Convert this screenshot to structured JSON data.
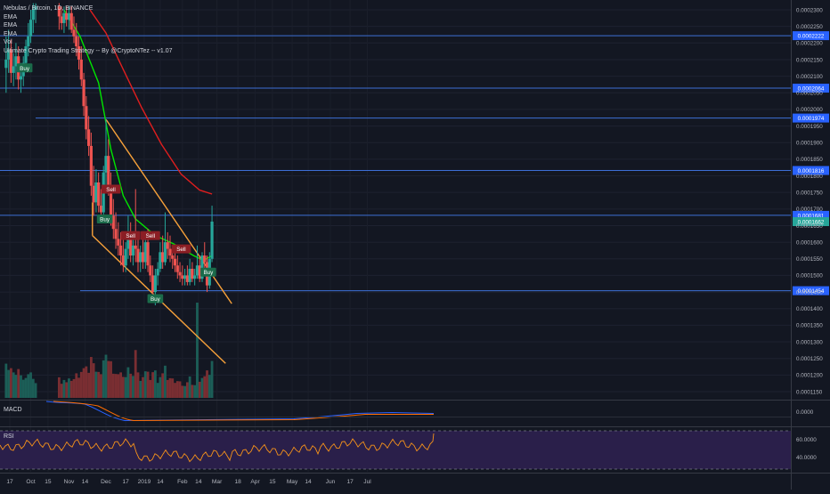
{
  "header": {
    "symbol_title": "Nebulas / Bitcoin, 1D, BINANCE",
    "indicators": [
      "EMA",
      "EMA",
      "EMA",
      "Vol",
      "Ultimate Crypto Trading Strategy -- By @CryptoNTez -- v1.07"
    ]
  },
  "panes": {
    "macd_label": "MACD",
    "macd_value": "0.0000",
    "rsi_label": "RSI",
    "rsi_ticks": [
      "60.0000",
      "40.0000"
    ]
  },
  "colors": {
    "background": "#131722",
    "up": "#26a69a",
    "down": "#ef5350",
    "ema_fast": "#00e600",
    "ema_slow": "#e01e1e",
    "trendline": "#f7a13a",
    "hline": "#3d6fd6",
    "rsi_band": "#2a1f4a",
    "rsi_line": "#f7931a",
    "macd_line": "#2962ff",
    "signal_line": "#ff6d00"
  },
  "chart_data": {
    "type": "candlestick",
    "y_ticks": [
      "0.0002300",
      "0.0002250",
      "0.0002200",
      "0.0002150",
      "0.0002100",
      "0.0002050",
      "0.0002000",
      "0.0001950",
      "0.0001900",
      "0.0001850",
      "0.0001800",
      "0.0001750",
      "0.0001700",
      "0.0001650",
      "0.0001600",
      "0.0001550",
      "0.0001500",
      "0.0001450",
      "0.0001400",
      "0.0001350",
      "0.0001300",
      "0.0001250",
      "0.0001200",
      "0.0001150"
    ],
    "ylim": [
      0.000114,
      0.0002315
    ],
    "x_ticks": [
      "17",
      "Oct",
      "15",
      "Nov",
      "14",
      "Dec",
      "17",
      "2019",
      "14",
      "Feb",
      "14",
      "Mar",
      "18",
      "Apr",
      "15",
      "May",
      "14",
      "Jun",
      "17",
      "Jul"
    ],
    "horizontal_levels": [
      {
        "value": 0.0002222,
        "label": "0.0002222"
      },
      {
        "value": 0.0002064,
        "label": "0.0002064"
      },
      {
        "value": 0.0001974,
        "label": "0.0001974"
      },
      {
        "value": 0.0001816,
        "label": "0.0001816"
      },
      {
        "value": 0.0001681,
        "label": "0.0001681"
      },
      {
        "value": 0.0001454,
        "label": "0.0001454"
      }
    ],
    "last_price": {
      "value": 0.0001662,
      "label": "0.0001662"
    },
    "signals": [
      {
        "text": "Buy",
        "type": "buy",
        "date": "2018-09-26",
        "price": 0.0002125
      },
      {
        "text": "Sell",
        "type": "sell",
        "date": "2018-12-05",
        "price": 0.000176
      },
      {
        "text": "Buy",
        "type": "buy",
        "date": "2018-11-30",
        "price": 0.000167
      },
      {
        "text": "Sell",
        "type": "sell",
        "date": "2018-12-21",
        "price": 0.000162
      },
      {
        "text": "Sell",
        "type": "sell",
        "date": "2019-01-06",
        "price": 0.000162
      },
      {
        "text": "Buy",
        "type": "buy",
        "date": "2019-01-10",
        "price": 0.000143
      },
      {
        "text": "Sell",
        "type": "sell",
        "date": "2019-01-31",
        "price": 0.000158
      },
      {
        "text": "Buy",
        "type": "buy",
        "date": "2019-02-22",
        "price": 0.000151
      }
    ],
    "trendlines": [
      {
        "from": {
          "date": "2018-12-01",
          "price": 0.000197
        },
        "to": {
          "date": "2019-03-13",
          "price": 0.0001415
        }
      },
      {
        "from": {
          "date": "2018-11-20",
          "price": 0.000162
        },
        "to": {
          "date": "2019-03-08",
          "price": 0.0001235
        }
      }
    ],
    "ema_fast_path": [
      {
        "date": "2018-10-28",
        "price": 0.00023
      },
      {
        "date": "2018-11-10",
        "price": 0.000222
      },
      {
        "date": "2018-11-25",
        "price": 0.000208
      },
      {
        "date": "2018-12-05",
        "price": 0.000188
      },
      {
        "date": "2018-12-15",
        "price": 0.000174
      },
      {
        "date": "2018-12-25",
        "price": 0.000167
      },
      {
        "date": "2019-01-10",
        "price": 0.000162
      },
      {
        "date": "2019-01-25",
        "price": 0.0001595
      },
      {
        "date": "2019-02-10",
        "price": 0.000156
      },
      {
        "date": "2019-02-18",
        "price": 0.0001545
      },
      {
        "date": "2019-02-25",
        "price": 0.000156
      }
    ],
    "ema_slow_path": [
      {
        "date": "2018-11-18",
        "price": 0.00023
      },
      {
        "date": "2018-12-01",
        "price": 0.000223
      },
      {
        "date": "2018-12-15",
        "price": 0.000212
      },
      {
        "date": "2018-12-30",
        "price": 0.0002005
      },
      {
        "date": "2019-01-15",
        "price": 0.0001895
      },
      {
        "date": "2019-01-31",
        "price": 0.0001805
      },
      {
        "date": "2019-02-15",
        "price": 0.0001757
      },
      {
        "date": "2019-02-25",
        "price": 0.0001745
      }
    ],
    "candles": [
      {
        "date": "2018-09-11",
        "o": 0.0002125,
        "h": 0.000222,
        "l": 0.000205,
        "c": 0.000215
      },
      {
        "date": "2018-09-13",
        "o": 0.000215,
        "h": 0.000224,
        "l": 0.000211,
        "c": 0.000218
      },
      {
        "date": "2018-09-15",
        "o": 0.000218,
        "h": 0.000221,
        "l": 0.000208,
        "c": 0.000211
      },
      {
        "date": "2018-09-17",
        "o": 0.000211,
        "h": 0.000217,
        "l": 0.000207,
        "c": 0.000213
      },
      {
        "date": "2018-09-19",
        "o": 0.000213,
        "h": 0.00022,
        "l": 0.000209,
        "c": 0.000216
      },
      {
        "date": "2018-09-21",
        "o": 0.000216,
        "h": 0.000219,
        "l": 0.000206,
        "c": 0.000209
      },
      {
        "date": "2018-09-23",
        "o": 0.000209,
        "h": 0.000214,
        "l": 0.000205,
        "c": 0.00021
      },
      {
        "date": "2018-09-25",
        "o": 0.00021,
        "h": 0.000216,
        "l": 0.000207,
        "c": 0.000214
      },
      {
        "date": "2018-09-27",
        "o": 0.000214,
        "h": 0.000221,
        "l": 0.000212,
        "c": 0.000219
      },
      {
        "date": "2018-09-29",
        "o": 0.000219,
        "h": 0.000226,
        "l": 0.000216,
        "c": 0.000222
      },
      {
        "date": "2018-10-01",
        "o": 0.000222,
        "h": 0.00023,
        "l": 0.00022,
        "c": 0.000227
      },
      {
        "date": "2018-10-03",
        "o": 0.000227,
        "h": 0.000232,
        "l": 0.000223,
        "c": 0.00023
      },
      {
        "date": "2018-10-05",
        "o": 0.00023,
        "h": 0.000232,
        "l": 0.000226,
        "c": 0.000231
      },
      {
        "date": "2018-10-24",
        "o": 0.000231,
        "h": 0.000232,
        "l": 0.000224,
        "c": 0.000228
      },
      {
        "date": "2018-10-26",
        "o": 0.000228,
        "h": 0.000231,
        "l": 0.000224,
        "c": 0.000226
      },
      {
        "date": "2018-10-28",
        "o": 0.000226,
        "h": 0.000231,
        "l": 0.000223,
        "c": 0.000229
      },
      {
        "date": "2018-10-30",
        "o": 0.000229,
        "h": 0.000231,
        "l": 0.000225,
        "c": 0.000227
      },
      {
        "date": "2018-11-01",
        "o": 0.000227,
        "h": 0.000231,
        "l": 0.000224,
        "c": 0.000229
      },
      {
        "date": "2018-11-03",
        "o": 0.000229,
        "h": 0.000231,
        "l": 0.000223,
        "c": 0.000224
      },
      {
        "date": "2018-11-05",
        "o": 0.000224,
        "h": 0.000228,
        "l": 0.00022,
        "c": 0.000222
      },
      {
        "date": "2018-11-07",
        "o": 0.000222,
        "h": 0.000226,
        "l": 0.000216,
        "c": 0.000219
      },
      {
        "date": "2018-11-09",
        "o": 0.000219,
        "h": 0.000222,
        "l": 0.000212,
        "c": 0.000215
      },
      {
        "date": "2018-11-11",
        "o": 0.000215,
        "h": 0.000219,
        "l": 0.000207,
        "c": 0.000209
      },
      {
        "date": "2018-11-13",
        "o": 0.000209,
        "h": 0.000211,
        "l": 0.000198,
        "c": 0.000201
      },
      {
        "date": "2018-11-15",
        "o": 0.000201,
        "h": 0.000204,
        "l": 0.000191,
        "c": 0.000194
      },
      {
        "date": "2018-11-17",
        "o": 0.000194,
        "h": 0.000198,
        "l": 0.000186,
        "c": 0.000189
      },
      {
        "date": "2018-11-19",
        "o": 0.000189,
        "h": 0.000193,
        "l": 0.000174,
        "c": 0.000177
      },
      {
        "date": "2018-11-21",
        "o": 0.000177,
        "h": 0.000183,
        "l": 0.000168,
        "c": 0.000172
      },
      {
        "date": "2018-11-23",
        "o": 0.000172,
        "h": 0.000182,
        "l": 0.000169,
        "c": 0.000178
      },
      {
        "date": "2018-11-25",
        "o": 0.000178,
        "h": 0.000181,
        "l": 0.000169,
        "c": 0.000171
      },
      {
        "date": "2018-11-27",
        "o": 0.000171,
        "h": 0.000176,
        "l": 0.000166,
        "c": 0.000169
      },
      {
        "date": "2018-11-29",
        "o": 0.000169,
        "h": 0.000183,
        "l": 0.000167,
        "c": 0.000181
      },
      {
        "date": "2018-12-01",
        "o": 0.000181,
        "h": 0.000197,
        "l": 0.000176,
        "c": 0.000186
      },
      {
        "date": "2018-12-03",
        "o": 0.000186,
        "h": 0.000191,
        "l": 0.000174,
        "c": 0.000177
      },
      {
        "date": "2018-12-05",
        "o": 0.000177,
        "h": 0.000181,
        "l": 0.000165,
        "c": 0.000168
      },
      {
        "date": "2018-12-07",
        "o": 0.000168,
        "h": 0.000173,
        "l": 0.000161,
        "c": 0.000164
      },
      {
        "date": "2018-12-09",
        "o": 0.000164,
        "h": 0.000169,
        "l": 0.000158,
        "c": 0.000161
      },
      {
        "date": "2018-12-11",
        "o": 0.000161,
        "h": 0.000166,
        "l": 0.000156,
        "c": 0.000159
      },
      {
        "date": "2018-12-13",
        "o": 0.000159,
        "h": 0.000163,
        "l": 0.000153,
        "c": 0.000156
      },
      {
        "date": "2018-12-15",
        "o": 0.000156,
        "h": 0.000161,
        "l": 0.000151,
        "c": 0.000153
      },
      {
        "date": "2018-12-17",
        "o": 0.000153,
        "h": 0.00016,
        "l": 0.000151,
        "c": 0.000158
      },
      {
        "date": "2018-12-19",
        "o": 0.000158,
        "h": 0.000168,
        "l": 0.000155,
        "c": 0.000162
      },
      {
        "date": "2018-12-21",
        "o": 0.000162,
        "h": 0.000166,
        "l": 0.000154,
        "c": 0.000156
      },
      {
        "date": "2018-12-23",
        "o": 0.000156,
        "h": 0.000163,
        "l": 0.000153,
        "c": 0.000159
      },
      {
        "date": "2018-12-25",
        "o": 0.000159,
        "h": 0.000176,
        "l": 0.000154,
        "c": 0.000158
      },
      {
        "date": "2018-12-27",
        "o": 0.000158,
        "h": 0.000161,
        "l": 0.000151,
        "c": 0.000154
      },
      {
        "date": "2018-12-29",
        "o": 0.000154,
        "h": 0.000159,
        "l": 0.000151,
        "c": 0.000157
      },
      {
        "date": "2018-12-31",
        "o": 0.000157,
        "h": 0.000161,
        "l": 0.000152,
        "c": 0.000154
      },
      {
        "date": "2019-01-02",
        "o": 0.000154,
        "h": 0.000163,
        "l": 0.000152,
        "c": 0.00016
      },
      {
        "date": "2019-01-04",
        "o": 0.00016,
        "h": 0.000164,
        "l": 0.000151,
        "c": 0.000153
      },
      {
        "date": "2019-01-06",
        "o": 0.000153,
        "h": 0.000156,
        "l": 0.000148,
        "c": 0.00015
      },
      {
        "date": "2019-01-08",
        "o": 0.00015,
        "h": 0.000153,
        "l": 0.000142,
        "c": 0.000145
      },
      {
        "date": "2019-01-10",
        "o": 0.000145,
        "h": 0.000152,
        "l": 0.000141,
        "c": 0.00015
      },
      {
        "date": "2019-01-12",
        "o": 0.00015,
        "h": 0.000154,
        "l": 0.000147,
        "c": 0.000152
      },
      {
        "date": "2019-01-14",
        "o": 0.000152,
        "h": 0.00016,
        "l": 0.000151,
        "c": 0.000157
      },
      {
        "date": "2019-01-16",
        "o": 0.000157,
        "h": 0.000162,
        "l": 0.000152,
        "c": 0.000154
      },
      {
        "date": "2019-01-18",
        "o": 0.000154,
        "h": 0.000169,
        "l": 0.000153,
        "c": 0.00016
      },
      {
        "date": "2019-01-20",
        "o": 0.00016,
        "h": 0.000163,
        "l": 0.000155,
        "c": 0.000158
      },
      {
        "date": "2019-01-22",
        "o": 0.000158,
        "h": 0.000162,
        "l": 0.000154,
        "c": 0.000156
      },
      {
        "date": "2019-01-24",
        "o": 0.000156,
        "h": 0.000159,
        "l": 0.000152,
        "c": 0.000155
      },
      {
        "date": "2019-01-26",
        "o": 0.000155,
        "h": 0.000158,
        "l": 0.000151,
        "c": 0.000153
      },
      {
        "date": "2019-01-28",
        "o": 0.000153,
        "h": 0.000156,
        "l": 0.000149,
        "c": 0.000151
      },
      {
        "date": "2019-01-30",
        "o": 0.000151,
        "h": 0.000154,
        "l": 0.000148,
        "c": 0.00015
      },
      {
        "date": "2019-02-01",
        "o": 0.00015,
        "h": 0.000153,
        "l": 0.000147,
        "c": 0.000149
      },
      {
        "date": "2019-02-03",
        "o": 0.000149,
        "h": 0.000152,
        "l": 0.000147,
        "c": 0.00015
      },
      {
        "date": "2019-02-05",
        "o": 0.00015,
        "h": 0.000153,
        "l": 0.000147,
        "c": 0.000148
      },
      {
        "date": "2019-02-07",
        "o": 0.000148,
        "h": 0.000155,
        "l": 0.000147,
        "c": 0.000152
      },
      {
        "date": "2019-02-09",
        "o": 0.000152,
        "h": 0.000154,
        "l": 0.000148,
        "c": 0.000149
      },
      {
        "date": "2019-02-11",
        "o": 0.000149,
        "h": 0.000152,
        "l": 0.000147,
        "c": 0.00015
      },
      {
        "date": "2019-02-13",
        "o": 0.00015,
        "h": 0.000159,
        "l": 0.000149,
        "c": 0.000153
      },
      {
        "date": "2019-02-15",
        "o": 0.000153,
        "h": 0.000156,
        "l": 0.000148,
        "c": 0.000149
      },
      {
        "date": "2019-02-17",
        "o": 0.000149,
        "h": 0.000157,
        "l": 0.000148,
        "c": 0.000156
      },
      {
        "date": "2019-02-19",
        "o": 0.000156,
        "h": 0.00016,
        "l": 0.000151,
        "c": 0.000154
      },
      {
        "date": "2019-02-21",
        "o": 0.000154,
        "h": 0.000156,
        "l": 0.000145,
        "c": 0.000147
      },
      {
        "date": "2019-02-23",
        "o": 0.000147,
        "h": 0.000157,
        "l": 0.000146,
        "c": 0.000155
      },
      {
        "date": "2019-02-25",
        "o": 0.000155,
        "h": 0.000171,
        "l": 0.000154,
        "c": 0.0001662
      }
    ]
  }
}
